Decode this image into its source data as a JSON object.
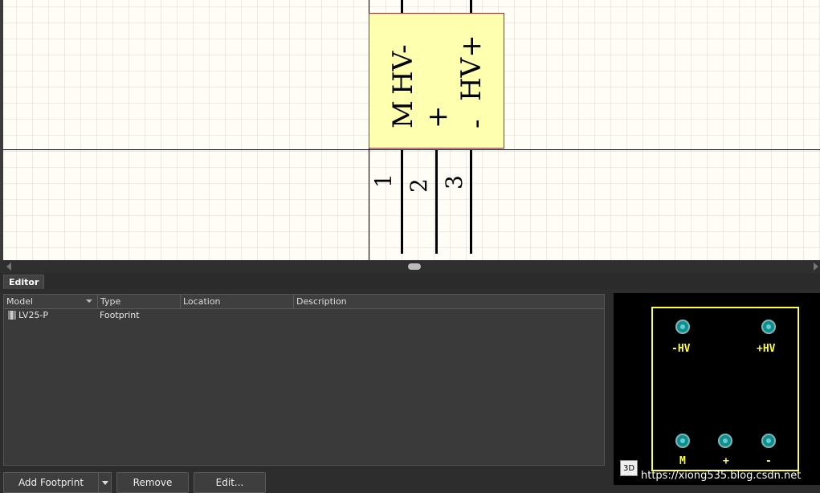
{
  "schematic": {
    "component": {
      "pin_labels": [
        "M",
        "HV-",
        "+",
        "-",
        "HV+"
      ],
      "pin_numbers": [
        "1",
        "2",
        "3"
      ]
    }
  },
  "editor": {
    "tab_label": "Editor",
    "columns": [
      "Model",
      "Type",
      "Location",
      "Description"
    ],
    "rows": [
      {
        "model": "LV25-P",
        "type": "Footprint",
        "location": "",
        "description": ""
      }
    ],
    "buttons": {
      "add_footprint": "Add Footprint",
      "remove": "Remove",
      "edit": "Edit..."
    }
  },
  "preview": {
    "labels": {
      "top_left": "-HV",
      "top_right": "+HV",
      "bottom_left": "M",
      "bottom_mid": "+",
      "bottom_right": "-"
    },
    "button_3d": "3D"
  },
  "watermark": "https://xiong535.blog.csdn.net",
  "colors": {
    "component_fill": "#ffffb0",
    "component_border": "#a52a2a",
    "silkscreen": "#ffff33",
    "pad": "#0d8f8f"
  }
}
